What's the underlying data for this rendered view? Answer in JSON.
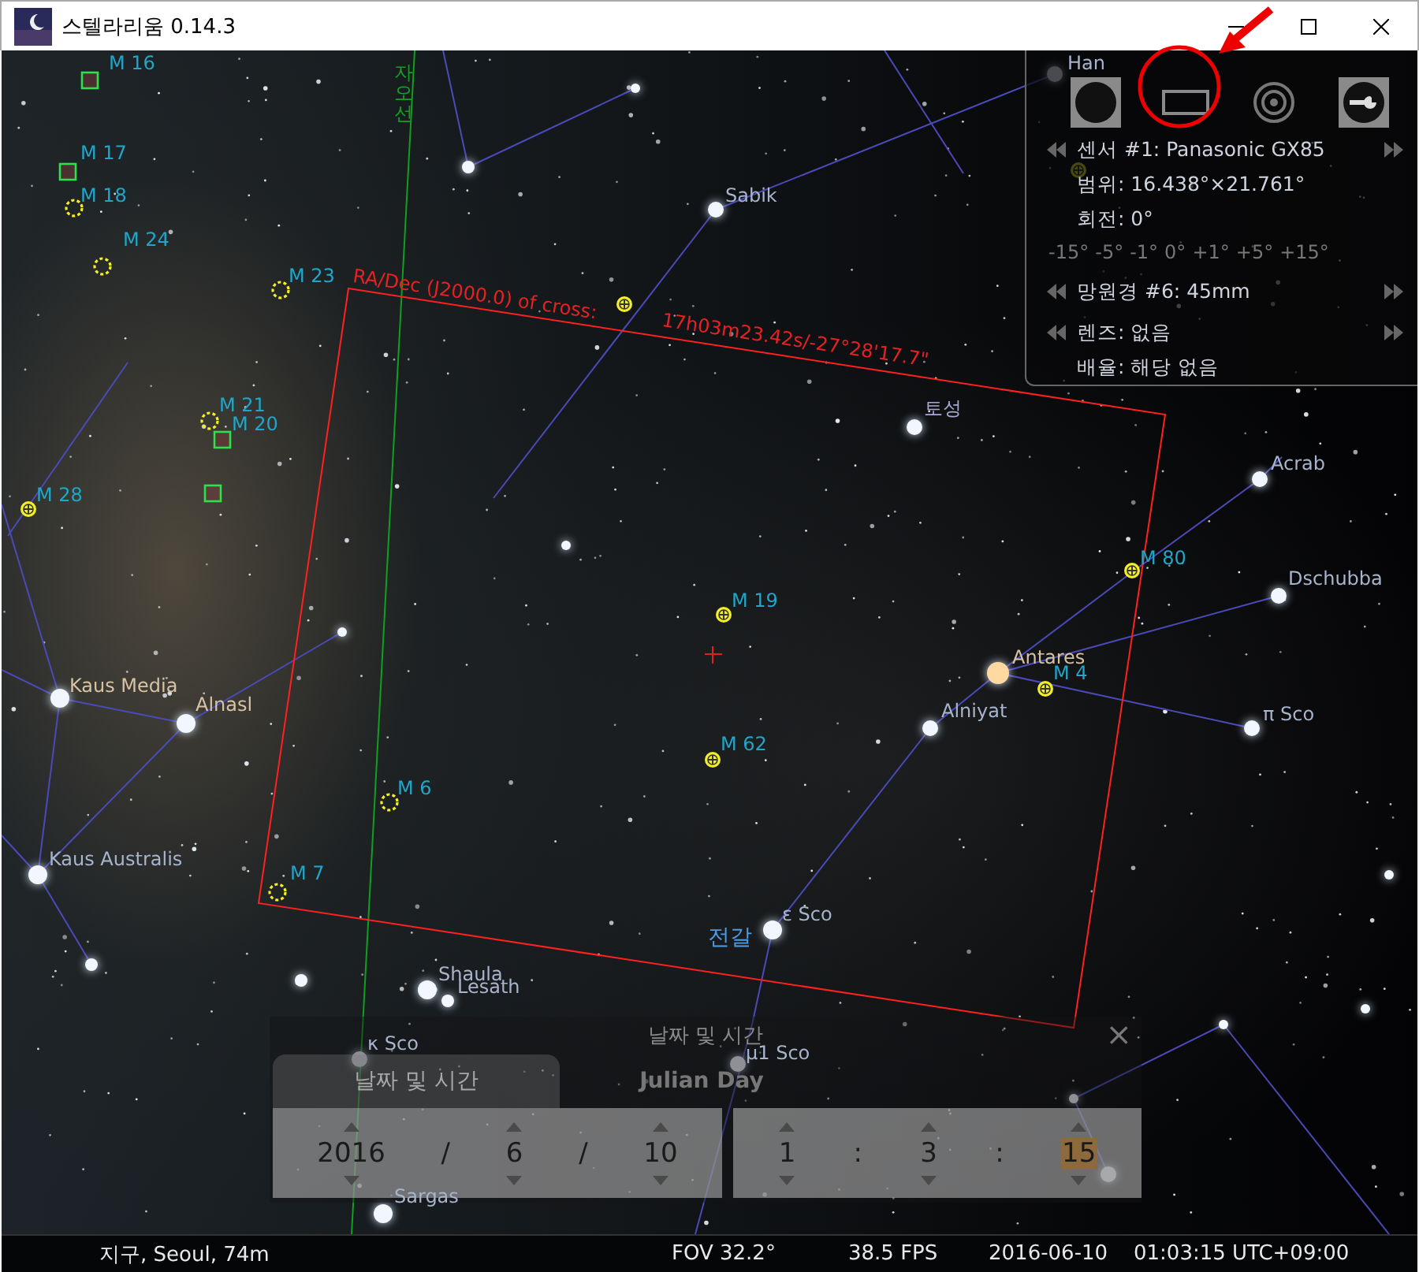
{
  "window": {
    "title": "스텔라리움 0.14.3"
  },
  "sky": {
    "labels": [
      {
        "text": "Han",
        "kind": "star"
      },
      {
        "text": "Sabik",
        "kind": "star"
      },
      {
        "text": "자오선",
        "kind": "grid"
      },
      {
        "text": "M 16",
        "kind": "nebula"
      },
      {
        "text": "M 17",
        "kind": "nebula"
      },
      {
        "text": "M 18",
        "kind": "open_cluster"
      },
      {
        "text": "M 24",
        "kind": "open_cluster"
      },
      {
        "text": "M 23",
        "kind": "open_cluster"
      },
      {
        "text": "M 21",
        "kind": "open_cluster"
      },
      {
        "text": "M 20",
        "kind": "nebula"
      },
      {
        "text": "M 28",
        "kind": "globular"
      },
      {
        "text": "RA/Dec (J2000.0) of cross:",
        "kind": "frame"
      },
      {
        "text": "17h03m23.42s/-27°28'17.7\"",
        "kind": "frame"
      },
      {
        "text": "토성",
        "kind": "planet"
      },
      {
        "text": "Acrab",
        "kind": "star"
      },
      {
        "text": "M 80",
        "kind": "globular"
      },
      {
        "text": "Dschubba",
        "kind": "star"
      },
      {
        "text": "M 19",
        "kind": "globular"
      },
      {
        "text": "Antares",
        "kind": "warm_star"
      },
      {
        "text": "M 4",
        "kind": "globular"
      },
      {
        "text": "Alniyat",
        "kind": "star"
      },
      {
        "text": "π Sco",
        "kind": "star"
      },
      {
        "text": "M 62",
        "kind": "globular"
      },
      {
        "text": "Kaus Media",
        "kind": "warm_star"
      },
      {
        "text": "Alnasl",
        "kind": "warm_star"
      },
      {
        "text": "M 6",
        "kind": "open_cluster"
      },
      {
        "text": "Kaus Australis",
        "kind": "star"
      },
      {
        "text": "M 7",
        "kind": "open_cluster"
      },
      {
        "text": "ε Sco",
        "kind": "star"
      },
      {
        "text": "전갈",
        "kind": "constellation"
      },
      {
        "text": "Shaula",
        "kind": "star"
      },
      {
        "text": "Lesath",
        "kind": "star"
      },
      {
        "text": "κ Sco",
        "kind": "star"
      },
      {
        "text": "μ1 Sco",
        "kind": "star"
      },
      {
        "text": "Sargas",
        "kind": "star"
      }
    ]
  },
  "oculars_panel": {
    "sensor": "센서 #1: Panasonic GX85",
    "range": "범위: 16.438°×21.761°",
    "rotation": "회전: 0°",
    "rotation_steps": [
      "-15°",
      "-5°",
      "-1°",
      "0°",
      "+1°",
      "+5°",
      "+15°"
    ],
    "telescope": "망원경 #6: 45mm",
    "lens": "렌즈: 없음",
    "magnification": "배율: 해당 없음"
  },
  "date_time_dialog": {
    "title": "날짜 및 시간",
    "close": "×",
    "tabs": [
      {
        "label": "날짜 및 시간",
        "selected": true
      },
      {
        "label": "Julian Day",
        "selected": false
      }
    ],
    "date_parts": [
      {
        "value": "2016",
        "selected": false
      },
      {
        "value": "6",
        "selected": false
      },
      {
        "value": "10",
        "selected": false
      }
    ],
    "date_separators": [
      "/",
      "/"
    ],
    "time_parts": [
      {
        "value": "1",
        "selected": false
      },
      {
        "value": "3",
        "selected": false
      },
      {
        "value": "15",
        "selected": true
      }
    ],
    "time_separators": [
      ":",
      ":"
    ]
  },
  "status_bar": {
    "location": "지구, Seoul, 74m",
    "fov": "FOV 32.2°",
    "fps": "38.5 FPS",
    "date": "2016-06-10",
    "time": "01:03:15 UTC+09:00"
  }
}
